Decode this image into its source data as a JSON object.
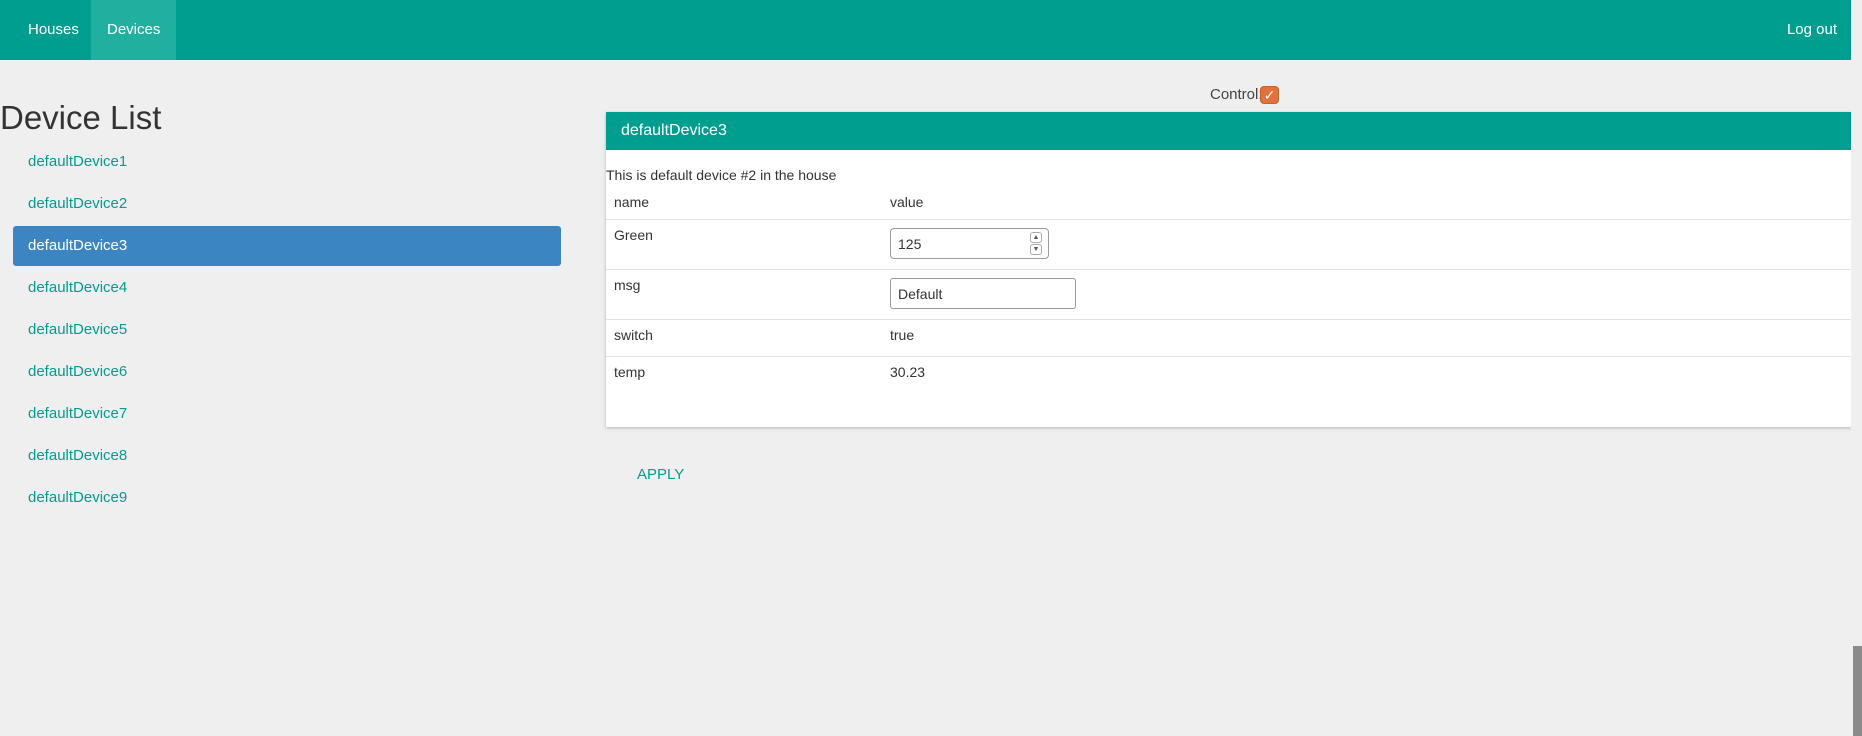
{
  "nav": {
    "houses": "Houses",
    "devices": "Devices",
    "logout": "Log out"
  },
  "device_list": {
    "title": "Device List",
    "items": [
      {
        "label": "defaultDevice1",
        "active": false
      },
      {
        "label": "defaultDevice2",
        "active": false
      },
      {
        "label": "defaultDevice3",
        "active": true
      },
      {
        "label": "defaultDevice4",
        "active": false
      },
      {
        "label": "defaultDevice5",
        "active": false
      },
      {
        "label": "defaultDevice6",
        "active": false
      },
      {
        "label": "defaultDevice7",
        "active": false
      },
      {
        "label": "defaultDevice8",
        "active": false
      },
      {
        "label": "defaultDevice9",
        "active": false
      }
    ]
  },
  "control": {
    "label": "Control:",
    "checked": true
  },
  "panel": {
    "title": "defaultDevice3",
    "description": "This is default device #2 in the house",
    "header": {
      "name": "name",
      "value": "value"
    },
    "rows": [
      {
        "name": "Green",
        "value": "125"
      },
      {
        "name": "msg",
        "value": "Default"
      },
      {
        "name": "switch",
        "value": "true"
      },
      {
        "name": "temp",
        "value": "30.23"
      }
    ]
  },
  "apply_label": "APPLY",
  "colors": {
    "primary": "#009e8e",
    "active_item": "#3a85c2",
    "checkbox": "#e2723a"
  }
}
